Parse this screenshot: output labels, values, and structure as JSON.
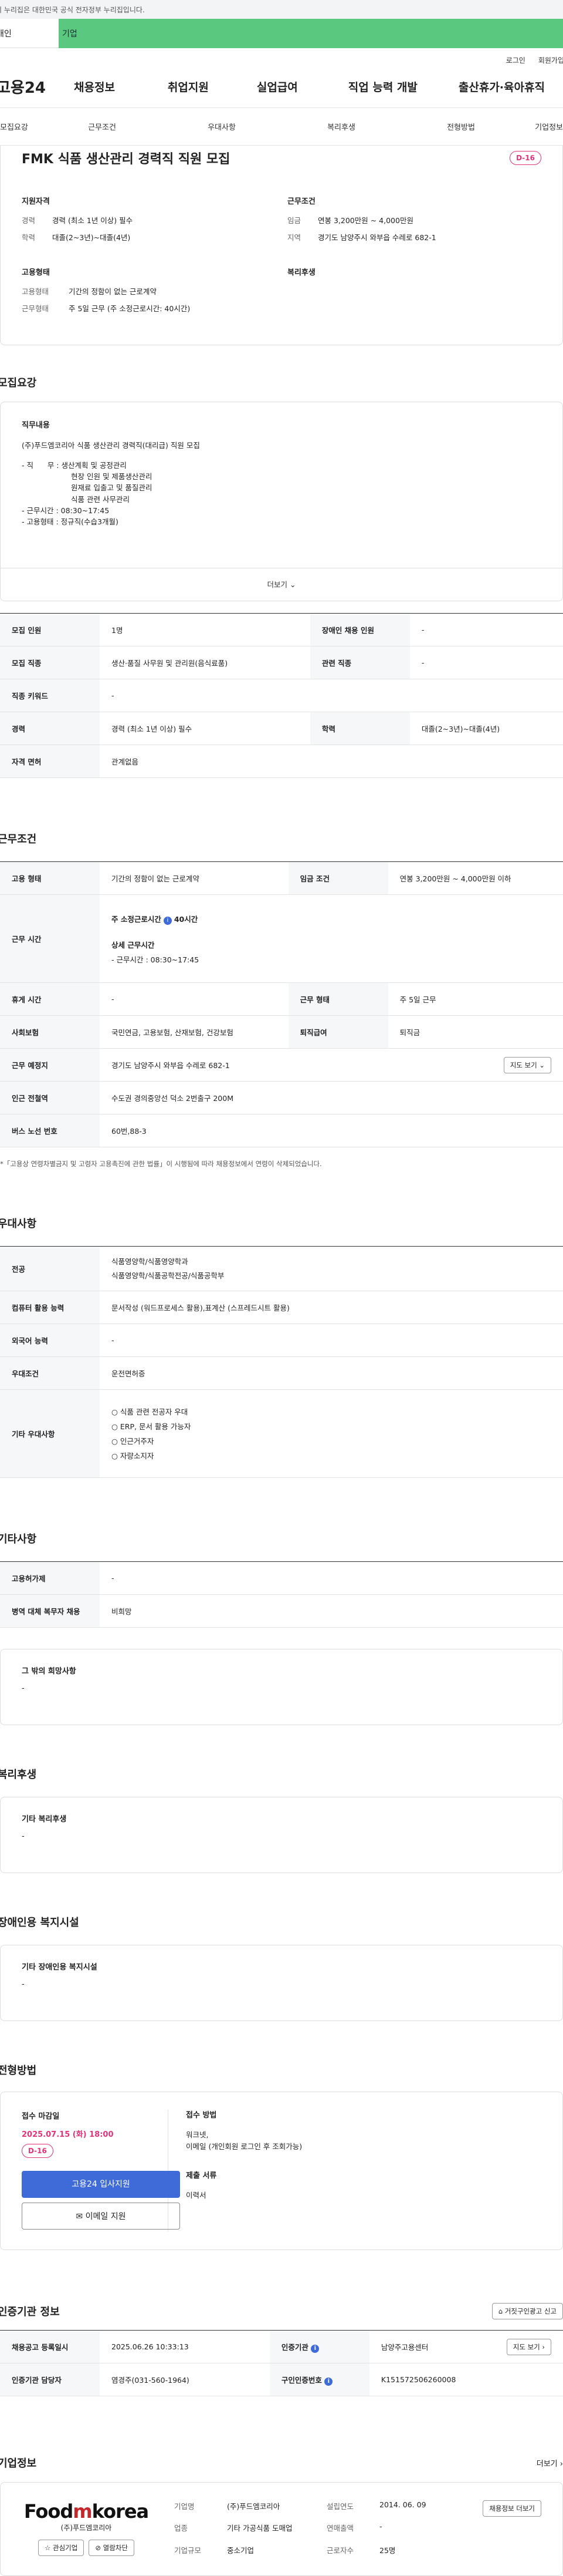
{
  "gov_banner": "이 누리집은 대한민국 공식 전자정부 누리집입니다.",
  "user_tabs": {
    "personal": "개인",
    "corp": "기업"
  },
  "util": {
    "login": "로그인",
    "join": "회원가입"
  },
  "logo": "고용24",
  "gnb": [
    "채용정보",
    "취업지원",
    "실업급여",
    "직업 능력 개발",
    "출산휴가·육아휴직"
  ],
  "anchor_tabs": [
    "모집요강",
    "근무조건",
    "우대사항",
    "복리후생",
    "전형방법",
    "기업정보"
  ],
  "job_title": "FMK 식품 생산관리 경력직 직원 모집",
  "dday": "D-16",
  "summary": {
    "qual_title": "지원자격",
    "career_k": "경력",
    "career_v": "경력 (최소 1년 이상) 필수",
    "edu_k": "학력",
    "edu_v": "대졸(2~3년)~대졸(4년)",
    "cond_title": "근무조건",
    "pay_k": "임금",
    "pay_v": "연봉 3,200만원 ~ 4,000만원",
    "area_k": "지역",
    "area_v": "경기도 남양주시 와부읍 수레로 682-1",
    "emp_title": "고용형태",
    "etype_k": "고용형태",
    "etype_v": "기간의 정함이 없는 근로계약",
    "wtype_k": "근무형태",
    "wtype_v": "주 5일 근무 (주 소정근로시간: 40시간)",
    "welfare_title": "복리후생"
  },
  "sec_recruit": "모집요강",
  "detail": {
    "title": "직무내용",
    "l1": "(주)푸드엠코리아 식품 생산관리 경력직(대리급) 직원 모집",
    "l2": "- 직      무 : 생산계획 및 공정관리",
    "l3": "현장 인원 및 제품생산관리",
    "l4": "원재료 입출고 및 품질관리",
    "l5": "식품 관련 사무관리",
    "l6": "- 근무시간 : 08:30~17:45",
    "l7": "- 고용형태 : 정규직(수습3개월)",
    "more": "더보기"
  },
  "recruit_tbl": {
    "r1k1": "모집 인원",
    "r1v1": "1명",
    "r1k2": "장애인 채용 인원",
    "r1v2": "-",
    "r2k1": "모집 직종",
    "r2v1": "생산·품질 사무원 및 관리원(음식료품)",
    "r2k2": "관련 직종",
    "r2v2": "-",
    "r3k1": "직종 키워드",
    "r3v1": "-",
    "r4k1": "경력",
    "r4v1": "경력 (최소 1년 이상) 필수",
    "r4k2": "학력",
    "r4v2": "대졸(2~3년)~대졸(4년)",
    "r5k1": "자격 면허",
    "r5v1": "관계없음"
  },
  "sec_cond": "근무조건",
  "cond_tbl": {
    "r1k1": "고용 형태",
    "r1v1": "기간의 정함이 없는 근로계약",
    "r1k2": "임금 조건",
    "r1v2": "연봉 3,200만원 ~ 4,000만원 이하",
    "r2k": "근무 시간",
    "r2a": "주 소정근로시간",
    "r2b": "40시간",
    "r2c": "상세 근무시간",
    "r2d": "- 근무시간 : 08:30~17:45",
    "r3k1": "휴게 시간",
    "r3v1": "-",
    "r3k2": "근무 형태",
    "r3v2": "주 5일 근무",
    "r4k1": "사회보험",
    "r4v1": "국민연금, 고용보험, 산재보험, 건강보험",
    "r4k2": "퇴직급여",
    "r4v2": "퇴직금",
    "r5k": "근무 예정지",
    "r5v": "경기도 남양주시 와부읍 수레로 682-1",
    "r5btn": "지도 보기",
    "r6k": "인근 전철역",
    "r6v": "수도권 경의중앙선 덕소 2번출구 200M",
    "r7k": "버스 노선 번호",
    "r7v": "60번,88-3"
  },
  "cond_notice": "*「고용상 연령차별금지 및 고령자 고용촉진에 관한 법률」이 시행됨에 따라 채용정보에서 연령이 삭제되었습니다.",
  "sec_pref": "우대사항",
  "pref_tbl": {
    "r1k": "전공",
    "r1a": "식품영양학/식품영양학과",
    "r1b": "식품영양학/식품공학전공/식품공학부",
    "r2k": "컴퓨터 활용 능력",
    "r2v": "문서작성 (워드프로세스 활용),표계산 (스프레드시트 활용)",
    "r3k": "외국어 능력",
    "r3v": "-",
    "r4k": "우대조건",
    "r4v": "운전면허증",
    "r5k": "기타 우대사항",
    "r5a": "식품 관련 전공자 우대",
    "r5b": "ERP, 문서 활용 가능자",
    "r5c": "인근거주자",
    "r5d": "자량소지자"
  },
  "sec_etc": "기타사항",
  "etc_tbl": {
    "r1k": "고용허가제",
    "r1v": "-",
    "r2k": "병역 대체 복무자 채용",
    "r2v": "비희망"
  },
  "hope": {
    "title": "그 밖의 희망사항",
    "v": "-"
  },
  "sec_welfare": "복리후생",
  "welfare": {
    "title": "기타 복리후생",
    "v": "-"
  },
  "sec_disabled": "장애인용 복지시설",
  "disabled": {
    "title": "기타 장애인용 복지시설",
    "v": "-"
  },
  "sec_apply": "전형방법",
  "apply": {
    "deadline_t": "접수 마감일",
    "deadline": "2025.07.15 (화) 18:00",
    "dday": "D-16",
    "btn_apply": "고용24 입사지원",
    "btn_email": "이메일 지원",
    "method_t": "접수 방법",
    "method1": "워크넷,",
    "method2": "이메일 (개인회원 로그인 후 조회가능)",
    "docs_t": "제출 서류",
    "docs": "이력서"
  },
  "sec_cert": "인증기관 정보",
  "cert_btn": "거짓구인광고 신고",
  "cert_tbl": {
    "r1k1": "채용공고 등록일시",
    "r1v1": "2025.06.26 10:33:13",
    "r1k2": "인증기관",
    "r1v2": "남양주고용센터",
    "r1btn": "지도 보기",
    "r2k1": "인증기관 담당자",
    "r2v1": "염경주(031-560-1964)",
    "r2k2": "구인인증번호",
    "r2v2": "K151572506260008"
  },
  "sec_company": "기업정보",
  "company_more": "더보기",
  "company": {
    "brand1": "Food",
    "brand2": "m",
    "brand3": "korea",
    "brand_sub": "(주)푸드엠코리아",
    "fav": "관심기업",
    "bookmark": "열람차단",
    "k1": "기업명",
    "v1": "(주)푸드엠코리아",
    "k2": "설립연도",
    "v2": "2014. 06. 09",
    "k3": "업종",
    "v3": "기타 가공식품 도매업",
    "k4": "연매출액",
    "v4": "-",
    "k5": "기업규모",
    "v5": "중소기업",
    "k6": "근로자수",
    "v6": "25명",
    "btn": "채용정보 더보기"
  }
}
